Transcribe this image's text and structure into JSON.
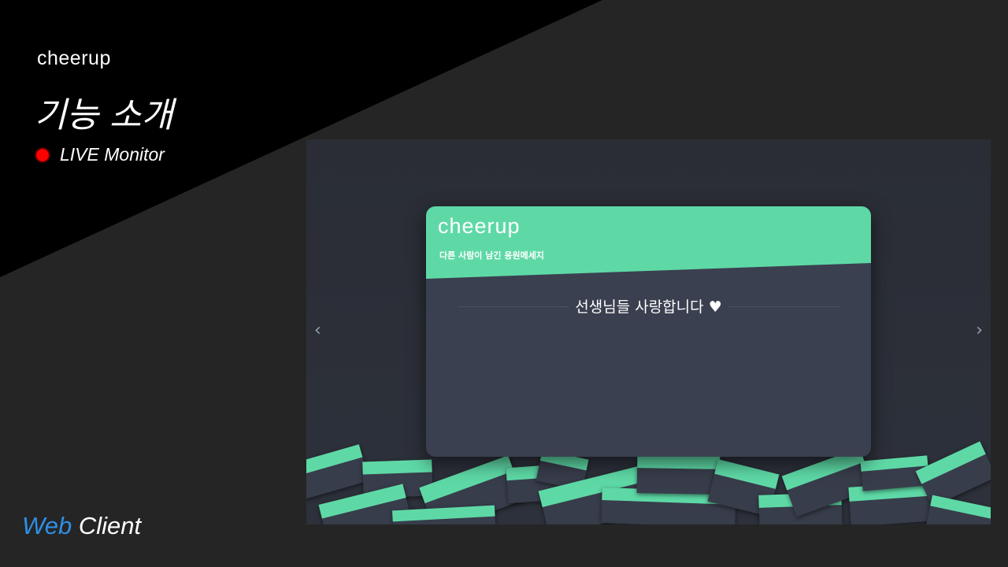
{
  "slide": {
    "brand": "cheerup",
    "title": "기능 소개",
    "live_label": "LIVE Monitor",
    "footer_web": "Web",
    "footer_client": "Client"
  },
  "screenshot": {
    "card": {
      "brand": "cheerup",
      "subtitle": "다른 사람이 남긴 응원메세지",
      "message": "선생님들 사랑합니다",
      "heart": "♥"
    },
    "prev_icon": "chevron-left-icon",
    "next_icon": "chevron-right-icon"
  },
  "colors": {
    "accent_green": "#5ed9a6",
    "live_dot": "#ff0000",
    "web_blue": "#2e8fe6"
  }
}
